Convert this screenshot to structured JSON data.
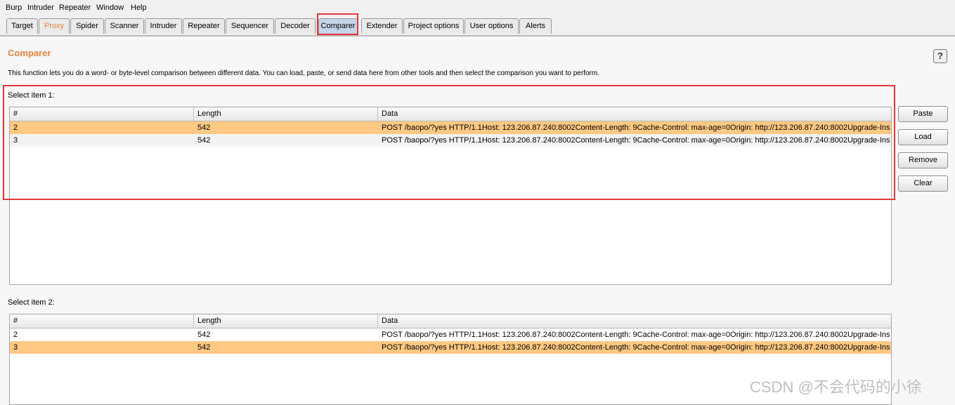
{
  "menu": [
    "Burp",
    "Intruder",
    "Repeater",
    "Window",
    "Help"
  ],
  "tabs": [
    "Target",
    "Proxy",
    "Spider",
    "Scanner",
    "Intruder",
    "Repeater",
    "Sequencer",
    "Decoder",
    "Comparer",
    "Extender",
    "Project options",
    "User options",
    "Alerts"
  ],
  "active_tab": "Comparer",
  "page": {
    "title": "Comparer",
    "help_label": "?",
    "description": "This function lets you do a word- or byte-level comparison between different data. You can load, paste, or send data here from other tools and then select the comparison you want to perform."
  },
  "item1": {
    "label": "Select item 1:",
    "columns": [
      "#",
      "Length",
      "Data"
    ],
    "rows": [
      {
        "num": "2",
        "length": "542",
        "data": "POST /baopo/?yes HTTP/1.1Host: 123.206.87.240:8002Content-Length: 9Cache-Control: max-age=0Origin: http://123.206.87.240:8002Upgrade-Inse...",
        "selected": true
      },
      {
        "num": "3",
        "length": "542",
        "data": "POST /baopo/?yes HTTP/1.1Host: 123.206.87.240:8002Content-Length: 9Cache-Control: max-age=0Origin: http://123.206.87.240:8002Upgrade-Inse...",
        "selected": false
      }
    ]
  },
  "item2": {
    "label": "Select item 2:",
    "columns": [
      "#",
      "Length",
      "Data"
    ],
    "rows": [
      {
        "num": "2",
        "length": "542",
        "data": "POST /baopo/?yes HTTP/1.1Host: 123.206.87.240:8002Content-Length: 9Cache-Control: max-age=0Origin: http://123.206.87.240:8002Upgrade-Inse...",
        "selected": false
      },
      {
        "num": "3",
        "length": "542",
        "data": "POST /baopo/?yes HTTP/1.1Host: 123.206.87.240:8002Content-Length: 9Cache-Control: max-age=0Origin: http://123.206.87.240:8002Upgrade-Inse...",
        "selected": true
      }
    ]
  },
  "buttons": {
    "paste": "Paste",
    "load": "Load",
    "remove": "Remove",
    "clear": "Clear"
  },
  "watermark": "CSDN @不会代码的小徐",
  "colors": {
    "accent": "#e8833a",
    "selected_row": "#ffc983",
    "highlight_box": "#e5373b",
    "active_tab": "#c4d5ea"
  }
}
